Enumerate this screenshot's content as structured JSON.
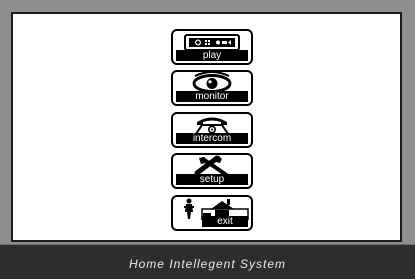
{
  "menu": {
    "items": [
      {
        "label": "play",
        "icon": "play-icon"
      },
      {
        "label": "monitor",
        "icon": "eye-icon"
      },
      {
        "label": "intercom",
        "icon": "telephone-icon"
      },
      {
        "label": "setup",
        "icon": "tools-icon"
      },
      {
        "label": "exit",
        "icon": "exit-home-icon"
      }
    ]
  },
  "footer": {
    "title": "Home Intellegent System"
  },
  "colors": {
    "background": "#8e8e8e",
    "panel": "#ffffff",
    "footer": "#2d2d2d",
    "button_border": "#000000"
  }
}
